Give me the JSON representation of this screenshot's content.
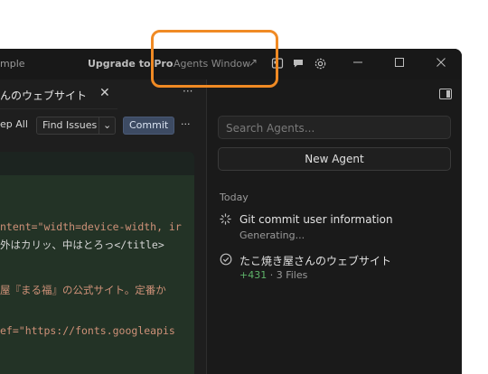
{
  "titlebar": {
    "app_title": "mple",
    "upgrade_label": "Upgrade to Pro",
    "agents_window_label": "Agents Window",
    "agents_window_icon": "external-arrow-icon"
  },
  "editor": {
    "tab_label": "んのウェブサイト",
    "tab_close": "✕",
    "more_label": "···",
    "actions": {
      "sweep_label": "ep All",
      "find_issues_label": "Find Issues",
      "dropdown_label": "⌄",
      "commit_label": "Commit",
      "more_label": "···"
    },
    "code_lines": [
      {
        "text": "ntent=\"width=device-width, ir",
        "color": "#ce9178"
      },
      {
        "text": "外はカリッ、中はとろっ</title>",
        "color": "#d4d4d4"
      },
      {
        "text": "屋『まる福』の公式サイト。定番か",
        "color": "#ce9178"
      },
      {
        "text": "ef=\"https://fonts.googleapis",
        "color": "#ce9178"
      }
    ]
  },
  "agents": {
    "search_placeholder": "Search Agents...",
    "new_agent_label": "New Agent",
    "section_today": "Today",
    "items": [
      {
        "title": "Git commit user information",
        "subtitle": "Generating...",
        "icon": "spinner-icon"
      },
      {
        "title": "たこ焼き屋さんのウェブサイト",
        "added": "+431",
        "files": " · 3 Files",
        "icon": "check-circle-icon"
      }
    ]
  },
  "colors": {
    "highlight": "#f08a24",
    "commit_bg": "#3d4b63",
    "added_green": "#5fb36a"
  }
}
